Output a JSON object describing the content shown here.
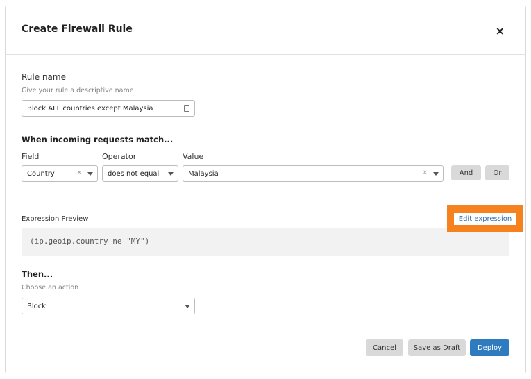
{
  "modal": {
    "title": "Create Firewall Rule",
    "close": "×"
  },
  "rule_name": {
    "label": "Rule name",
    "hint": "Give your rule a descriptive name",
    "value": "Block ALL countries except Malaysia"
  },
  "match": {
    "heading": "When incoming requests match...",
    "field_label": "Field",
    "operator_label": "Operator",
    "value_label": "Value",
    "field": "Country",
    "operator": "does not equal",
    "value": "Malaysia",
    "and": "And",
    "or": "Or",
    "clear": "×"
  },
  "preview": {
    "label": "Expression Preview",
    "edit": "Edit expression",
    "expression": "(ip.geoip.country ne \"MY\")"
  },
  "then": {
    "heading": "Then...",
    "hint": "Choose an action",
    "action": "Block"
  },
  "footer": {
    "cancel": "Cancel",
    "draft": "Save as Draft",
    "deploy": "Deploy"
  },
  "colors": {
    "accent": "#f6821f",
    "primary": "#2f7bbf"
  }
}
